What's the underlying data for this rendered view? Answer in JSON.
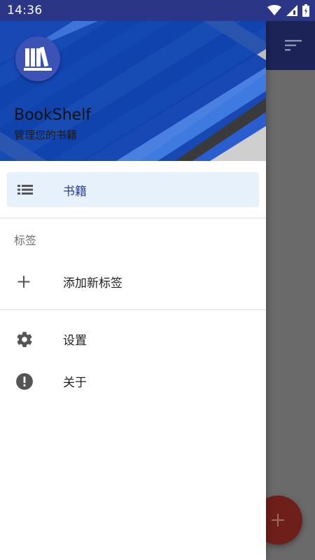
{
  "status_bar": {
    "time": "14:36",
    "icons": [
      "wifi-icon",
      "signal-icon",
      "battery-icon"
    ]
  },
  "drawer_header": {
    "app_name": "BookShelf",
    "subtitle": "管理您的书籍",
    "logo_icon": "books-icon"
  },
  "menu": {
    "books": {
      "label": "书籍",
      "icon": "list-icon",
      "selected": true
    },
    "tags_section_title": "标签",
    "add_tag": {
      "label": "添加新标签",
      "icon": "plus-icon"
    },
    "settings": {
      "label": "设置",
      "icon": "gear-icon"
    },
    "about": {
      "label": "关于",
      "icon": "info-icon"
    }
  },
  "background_app": {
    "toolbar_icon": "sort-icon",
    "fab_icon": "plus-icon"
  },
  "colors": {
    "status_bar": "#2b3687",
    "header_blue": "#1746b0",
    "selected_bg": "#e7f1fb",
    "selected_text": "#2c3e98",
    "fab": "#6e1f1a"
  }
}
